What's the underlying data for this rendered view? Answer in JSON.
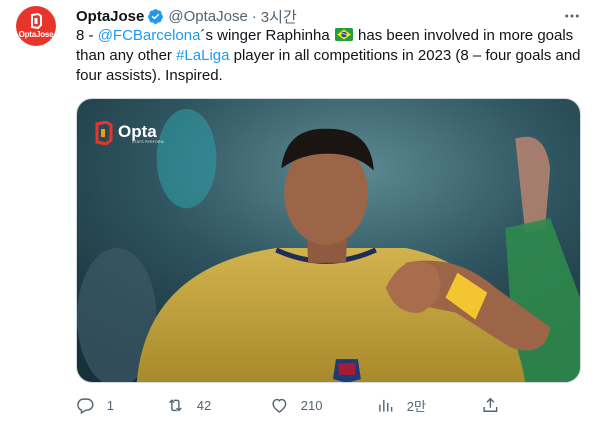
{
  "author": {
    "display_name": "OptaJose",
    "handle": "@OptaJose",
    "separator": "·",
    "time": "3시간",
    "avatar_text": "OptaJose"
  },
  "tweet": {
    "text_1": "8 - ",
    "mention": "@FCBarcelona",
    "text_2": "´s winger Raphinha ",
    "flag_icon": "brazil-flag-icon",
    "text_3": " has been involved in more goals than any other ",
    "hashtag": "#LaLiga",
    "text_4": " player in all competitions in 2023 (8 – four goals and four assists). Inspired."
  },
  "media": {
    "brand_name": "Opta",
    "brand_sub": "STATS PERFORM"
  },
  "actions": {
    "reply_count": "1",
    "retweet_count": "42",
    "like_count": "210",
    "views_count": "2만"
  },
  "colors": {
    "accent": "#1d9bf0",
    "brand_red": "#e8352c",
    "muted": "#536471"
  }
}
